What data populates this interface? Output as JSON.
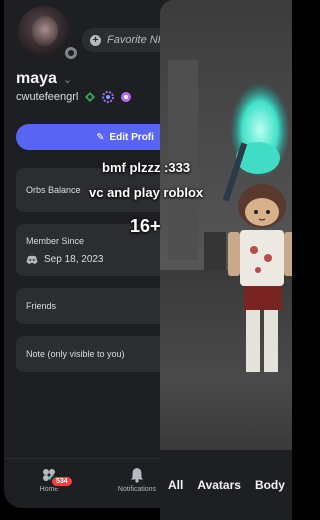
{
  "profile": {
    "favorite_npc_placeholder": "Favorite NPC",
    "display_name": "maya",
    "username": "cwutefeengrl",
    "edit_profile_label": "Edit Profi",
    "orbs_balance_label": "Orbs Balance",
    "member_since_label": "Member Since",
    "member_since_date": "Sep 18, 2023",
    "friends_label": "Friends",
    "note_label": "Note (only visible to you)"
  },
  "nav": {
    "home_label": "Home",
    "home_badge": "534",
    "notifications_label": "Notifications"
  },
  "game": {
    "tabs": [
      "All",
      "Avatars",
      "Body"
    ]
  },
  "overlay": {
    "line1": "bmf plzzz :333",
    "line2": "vc and play roblox",
    "line3": "16+"
  },
  "colors": {
    "accent": "#5865f2",
    "panel": "#1e1f22",
    "card": "#2b2d31",
    "badge_red": "#f23f43"
  }
}
